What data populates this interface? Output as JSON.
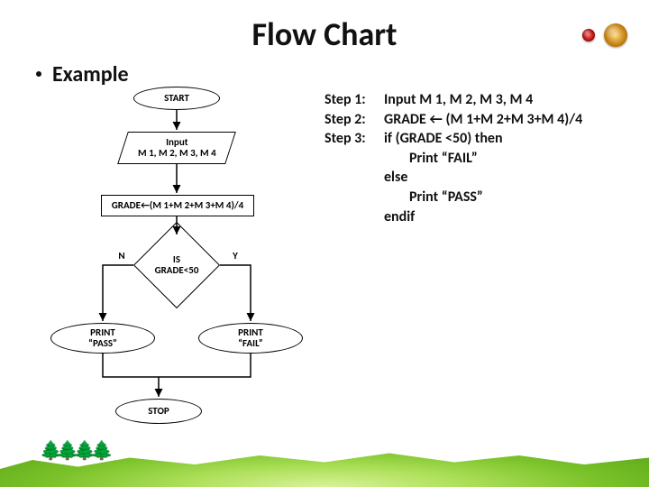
{
  "title": "Flow Chart",
  "example_label": "Example",
  "flow": {
    "start": "START",
    "input_line1": "Input",
    "input_line2": "M 1, M 2, M 3, M 4",
    "grade": "GRADE←(M 1+M 2+M 3+M 4)/4",
    "decision_line1": "IS",
    "decision_line2": "GRADE<50",
    "n": "N",
    "y": "Y",
    "pass_line1": "PRINT",
    "pass_line2": "“PASS”",
    "fail_line1": "PRINT",
    "fail_line2": "“FAIL”",
    "stop": "STOP"
  },
  "steps": {
    "s1_label": "Step 1:",
    "s1_val": "Input M 1, M 2, M 3, M 4",
    "s2_label": "Step 2:",
    "s2_val": "GRADE ← (M 1+M 2+M 3+M 4)/4",
    "s3_label": "Step 3:",
    "s3_val": "if (GRADE <50) then",
    "s3_then": "Print “FAIL”",
    "s3_else": "else",
    "s3_else_then": "Print “PASS”",
    "s3_endif": "endif"
  }
}
